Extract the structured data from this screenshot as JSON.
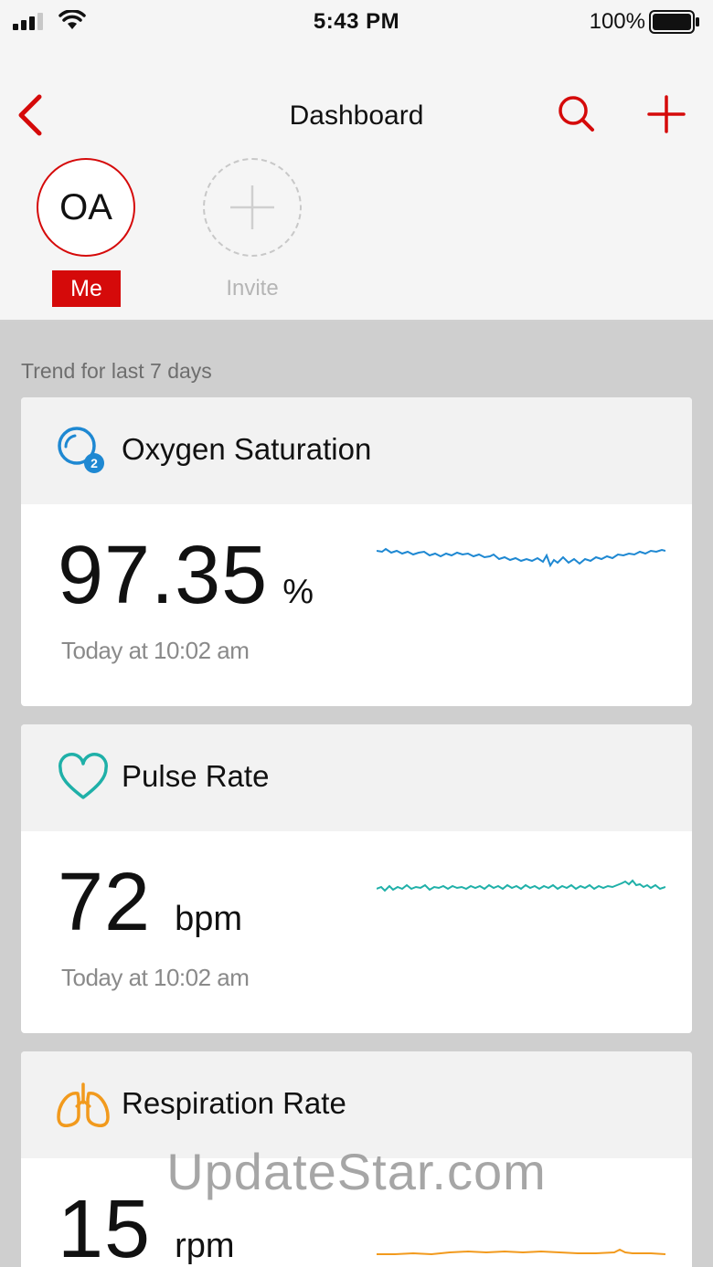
{
  "status_bar": {
    "time": "5:43 PM",
    "battery": "100%",
    "icons": [
      "signal-icon",
      "wifi-icon",
      "battery-icon"
    ]
  },
  "nav": {
    "title": "Dashboard",
    "icons": [
      "chevron-left-icon",
      "search-icon",
      "plus-icon"
    ]
  },
  "profiles": {
    "me_initials": "OA",
    "me_label": "Me",
    "invite_label": "Invite"
  },
  "section": {
    "label": "Trend for last 7 days"
  },
  "cards": [
    {
      "title": "Oxygen Saturation",
      "value": "97.35",
      "unit": "%",
      "time": "Today at 10:02 am",
      "icon": "oxygen-icon",
      "color": "#1e88d2"
    },
    {
      "title": "Pulse Rate",
      "value": "72",
      "unit": "bpm",
      "time": "Today at 10:02 am",
      "icon": "heart-icon",
      "color": "#1fb0a8"
    },
    {
      "title": "Respiration Rate",
      "value": "15",
      "unit": "rpm",
      "time": "",
      "icon": "lungs-icon",
      "color": "#f29a1d"
    }
  ],
  "colors": {
    "accent": "#d50a0a"
  },
  "watermark": "UpdateStar.com"
}
